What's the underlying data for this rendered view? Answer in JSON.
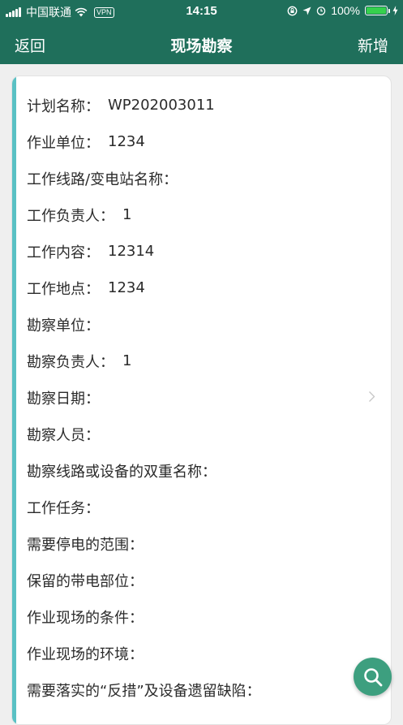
{
  "status_bar": {
    "carrier": "中国联通",
    "vpn": "VPN",
    "time": "14:15",
    "battery": "100%",
    "battery_level": 1.0,
    "colors": {
      "battery_fill": "#35d14d"
    }
  },
  "nav": {
    "back_label": "返回",
    "title": "现场勘察",
    "add_label": "新增"
  },
  "fields": [
    {
      "label": "计划名称：",
      "value": "WP202003011"
    },
    {
      "label": "作业单位：",
      "value": "1234"
    },
    {
      "label": "工作线路/变电站名称：",
      "value": ""
    },
    {
      "label": "工作负责人：",
      "value": "1"
    },
    {
      "label": "工作内容：",
      "value": "12314"
    },
    {
      "label": "工作地点：",
      "value": "1234"
    },
    {
      "label": "勘察单位：",
      "value": ""
    },
    {
      "label": "勘察负责人：",
      "value": "1"
    },
    {
      "label": "勘察日期：",
      "value": ""
    },
    {
      "label": "勘察人员：",
      "value": ""
    },
    {
      "label": "勘察线路或设备的双重名称：",
      "value": ""
    },
    {
      "label": "工作任务：",
      "value": ""
    },
    {
      "label": "需要停电的范围：",
      "value": ""
    },
    {
      "label": "保留的带电部位：",
      "value": ""
    },
    {
      "label": "作业现场的条件：",
      "value": ""
    },
    {
      "label": "作业现场的环境：",
      "value": ""
    },
    {
      "label": "需要落实的“反措”及设备遗留缺陷：",
      "value": ""
    }
  ],
  "icons": {
    "date_chevron": "chevron-right-icon",
    "fab": "search-icon"
  },
  "colors": {
    "header": "#1f6f5b",
    "accent": "#5ac1c4",
    "fab": "#3d9f7f",
    "background": "#efefef"
  }
}
